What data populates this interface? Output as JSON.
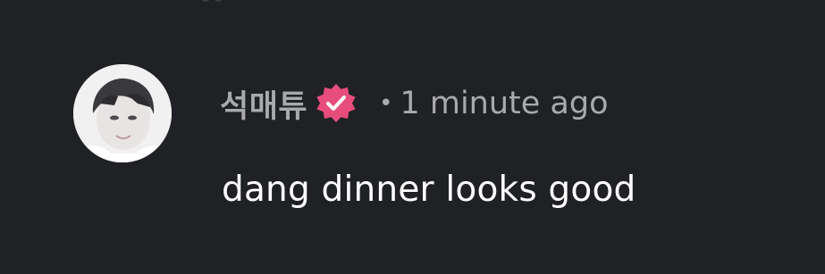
{
  "comment": {
    "username": "석매튜",
    "verified_icon": "verified-badge-icon",
    "separator": "•",
    "timestamp": "1 minute ago",
    "text": "dang dinner looks good"
  },
  "colors": {
    "background": "#202125",
    "muted_text": "#a8a9ad",
    "body_text": "#ffffff",
    "verified_badge": "#e64d7d"
  }
}
